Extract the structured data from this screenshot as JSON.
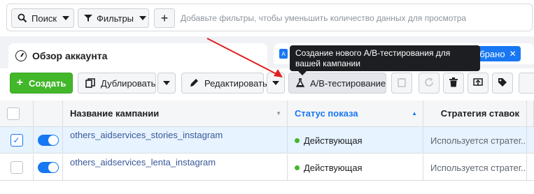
{
  "filterbar": {
    "search_label": "Поиск",
    "filters_label": "Фильтры",
    "add_label": "+",
    "hint": "Добавьте фильтры, чтобы уменьшить количество данных для просмотра"
  },
  "tabs": {
    "overview_label": "Обзор аккаунта",
    "selected_label": "выбрано",
    "selected_close": "✕"
  },
  "toolbar": {
    "create_label": "Создать",
    "duplicate_label": "Дублировать",
    "edit_label": "Редактировать",
    "ab_label": "A/B-тестирование"
  },
  "tooltip": {
    "text": "Создание нового A/B-тестирования для вашей кампании"
  },
  "table": {
    "columns": [
      "Название кампании",
      "Статус показа",
      "Стратегия ставок"
    ],
    "rows": [
      {
        "name": "others_aidservices_stories_instagram",
        "status": "Действующая",
        "strategy": "Используется стратег...",
        "selected": true
      },
      {
        "name": "others_aidservices_lenta_instagram",
        "status": "Действующая",
        "strategy": "Используется стратег...",
        "selected": false
      }
    ]
  },
  "colors": {
    "accent": "#1877f2",
    "create": "#42b72a",
    "annotation_arrow": "#e02020"
  }
}
